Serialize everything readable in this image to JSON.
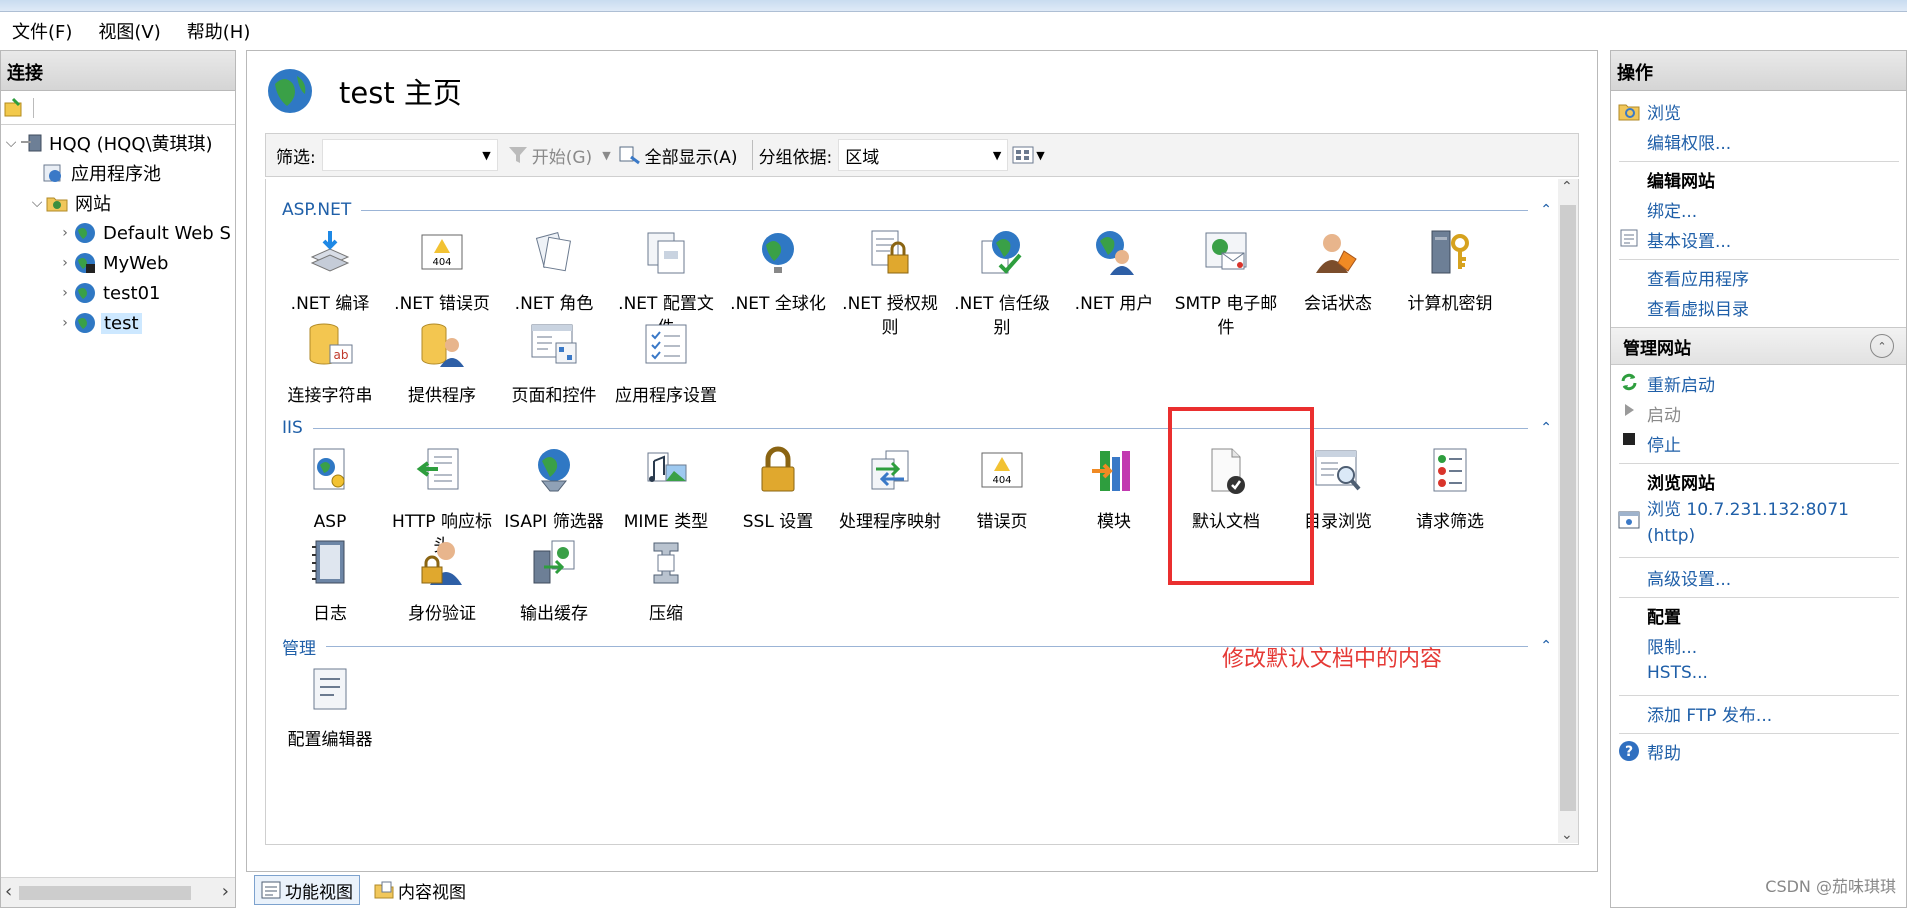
{
  "menu": [
    "文件(F)",
    "视图(V)",
    "帮助(H)"
  ],
  "connections": {
    "title": "连接",
    "tree": [
      {
        "label": "HQQ (HQQ\\黄琪琪)"
      },
      {
        "label": "应用程序池"
      },
      {
        "label": "网站"
      },
      {
        "label": "Default Web S"
      },
      {
        "label": "MyWeb"
      },
      {
        "label": "test01"
      },
      {
        "label": "test"
      }
    ]
  },
  "center": {
    "title": "test 主页",
    "filter": {
      "label": "筛选:",
      "go": "开始(G)",
      "show_all": "全部显示(A)",
      "group_by_label": "分组依据:",
      "group_by_value": "区域"
    },
    "groups": [
      {
        "name": "ASP.NET",
        "features": [
          ".NET 编译",
          ".NET 错误页",
          ".NET 角色",
          ".NET 配置文件",
          ".NET 全球化",
          ".NET 授权规则",
          ".NET 信任级别",
          ".NET 用户",
          "SMTP 电子邮件",
          "会话状态",
          "计算机密钥",
          "连接字符串",
          "提供程序",
          "页面和控件",
          "应用程序设置"
        ]
      },
      {
        "name": "IIS",
        "features": [
          "ASP",
          "HTTP 响应标头",
          "ISAPI 筛选器",
          "MIME 类型",
          "SSL 设置",
          "处理程序映射",
          "错误页",
          "模块",
          "默认文档",
          "目录浏览",
          "请求筛选",
          "日志",
          "身份验证",
          "输出缓存",
          "压缩"
        ]
      },
      {
        "name": "管理",
        "features": [
          "配置编辑器"
        ]
      }
    ],
    "annotation": "修改默认文档中的内容",
    "view_tabs": [
      "功能视图",
      "内容视图"
    ]
  },
  "actions": {
    "title": "操作",
    "browse": "浏览",
    "edit_permissions": "编辑权限...",
    "edit_site": "编辑网站",
    "bindings": "绑定...",
    "basic_settings": "基本设置...",
    "view_apps": "查看应用程序",
    "view_vdirs": "查看虚拟目录",
    "manage_site": "管理网站",
    "restart": "重新启动",
    "start": "启动",
    "stop": "停止",
    "browse_site": "浏览网站",
    "browse_url": "浏览 10.7.231.132:8071",
    "browse_proto": "(http)",
    "advanced": "高级设置...",
    "config": "配置",
    "limits": "限制...",
    "hsts": "HSTS...",
    "add_ftp": "添加 FTP 发布...",
    "help": "帮助"
  },
  "watermark": "CSDN @茄味琪琪",
  "colors": {
    "link": "#1f5fa8",
    "annotation": "#e53935",
    "highlight_box": "#ea2f2f"
  }
}
